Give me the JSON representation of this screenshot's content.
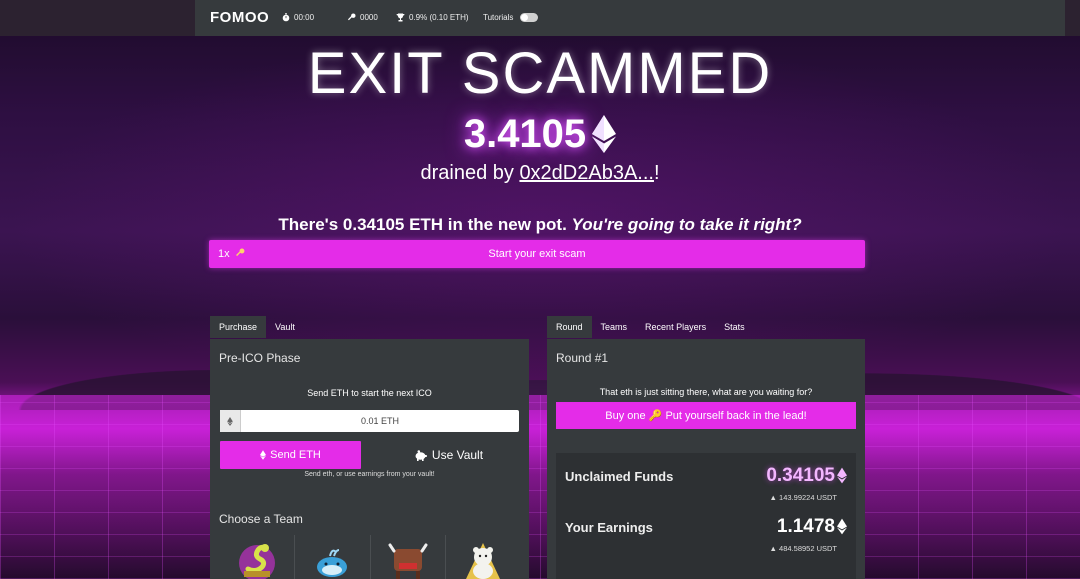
{
  "navbar": {
    "brand": "FOMOO",
    "timer": "00:00",
    "keys": "0000",
    "pot": "0.9% (0.10 ETH)",
    "tutorials_label": "Tutorials"
  },
  "hero": {
    "title": "EXIT SCAMMED",
    "amount": "3.4105",
    "drained_prefix": "drained by ",
    "drained_address": "0x2dD2Ab3A...",
    "drained_suffix": "!"
  },
  "pot_message": {
    "text": "There's 0.34105 ETH in the new pot. ",
    "emphasis": "You're going to take it right?"
  },
  "exit_bar": {
    "quantity": "1x",
    "label": "Start your exit scam"
  },
  "left_panel": {
    "tabs": [
      {
        "label": "Purchase",
        "active": true
      },
      {
        "label": "Vault",
        "active": false
      }
    ],
    "heading": "Pre-ICO Phase",
    "send_hint": "Send ETH to start the next ICO",
    "eth_input_value": "0.01 ETH",
    "send_button": "Send ETH",
    "vault_button": "Use Vault",
    "send_subtext": "Send eth, or use earnings from your vault!",
    "team_heading": "Choose a Team",
    "teams": [
      "snake-team",
      "whale-team",
      "bull-team",
      "bear-team"
    ]
  },
  "right_panel": {
    "tabs": [
      {
        "label": "Round",
        "active": true
      },
      {
        "label": "Teams",
        "active": false
      },
      {
        "label": "Recent Players",
        "active": false
      },
      {
        "label": "Stats",
        "active": false
      }
    ],
    "heading": "Round #1",
    "hint": "That eth is just sitting there, what are you waiting for?",
    "buy_button": "Buy one 🔑 Put yourself back in the lead!",
    "unclaimed_label": "Unclaimed Funds",
    "unclaimed_value": "0.34105",
    "unclaimed_usd": "143.99224 USDT",
    "earnings_label": "Your Earnings",
    "earnings_value": "1.1478",
    "earnings_usd": "484.58952 USDT"
  },
  "colors": {
    "accent": "#e42ce8",
    "panel": "#363a3d",
    "navbar": "#363a3d"
  }
}
